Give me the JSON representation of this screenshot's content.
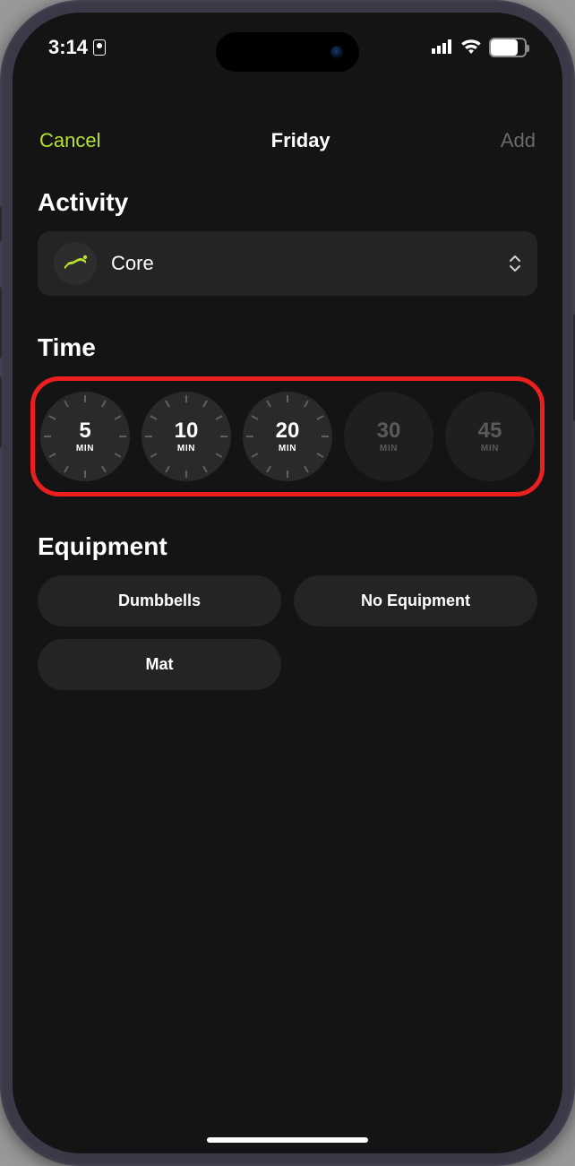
{
  "status": {
    "time": "3:14",
    "battery_percent": "79"
  },
  "nav": {
    "cancel": "Cancel",
    "title": "Friday",
    "add": "Add"
  },
  "sections": {
    "activity_heading": "Activity",
    "time_heading": "Time",
    "equipment_heading": "Equipment"
  },
  "activity": {
    "selected": "Core"
  },
  "time_options": [
    {
      "value": "5",
      "unit": "MIN",
      "enabled": true
    },
    {
      "value": "10",
      "unit": "MIN",
      "enabled": true
    },
    {
      "value": "20",
      "unit": "MIN",
      "enabled": true
    },
    {
      "value": "30",
      "unit": "MIN",
      "enabled": false
    },
    {
      "value": "45",
      "unit": "MIN",
      "enabled": false
    }
  ],
  "equipment_options": [
    {
      "label": "Dumbbells"
    },
    {
      "label": "No Equipment"
    },
    {
      "label": "Mat"
    }
  ],
  "colors": {
    "accent_green": "#b7e22b",
    "highlight_red": "#ec1f1f",
    "background": "#141414",
    "card": "#242424"
  }
}
